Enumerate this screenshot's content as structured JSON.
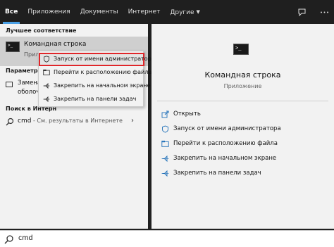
{
  "tabs": [
    {
      "label": "Все"
    },
    {
      "label": "Приложения"
    },
    {
      "label": "Документы"
    },
    {
      "label": "Интернет"
    },
    {
      "label": "Другие"
    }
  ],
  "left": {
    "best_header": "Лучшее соответствие",
    "best_title": "Командная строка",
    "best_sub": "Прил",
    "params_header": "Параметры",
    "param_line1": "Замена",
    "param_line2": "оболоч",
    "web_header": "Поиск в Интерн",
    "web_query": "cmd",
    "web_sub": " - См. результаты в Интернете"
  },
  "context_menu": [
    {
      "label": "Запуск от имени администратора",
      "icon": "shield-icon"
    },
    {
      "label": "Перейти к расположению файла",
      "icon": "folder-icon"
    },
    {
      "label": "Закрепить на начальном экране",
      "icon": "pin-icon"
    },
    {
      "label": "Закрепить на панели задач",
      "icon": "pin-icon"
    }
  ],
  "right": {
    "title": "Командная строка",
    "subtitle": "Приложение",
    "actions": [
      {
        "label": "Открыть",
        "icon": "open-icon"
      },
      {
        "label": "Запуск от имени администратора",
        "icon": "shield-icon"
      },
      {
        "label": "Перейти к расположению файла",
        "icon": "folder-icon"
      },
      {
        "label": "Закрепить на начальном экране",
        "icon": "pin-icon"
      },
      {
        "label": "Закрепить на панели задач",
        "icon": "pin-icon"
      }
    ]
  },
  "search": {
    "value": "cmd"
  },
  "colors": {
    "accent": "#4aa0e6",
    "highlight_border": "#e0262a",
    "action_icon": "#1e6fb8"
  }
}
